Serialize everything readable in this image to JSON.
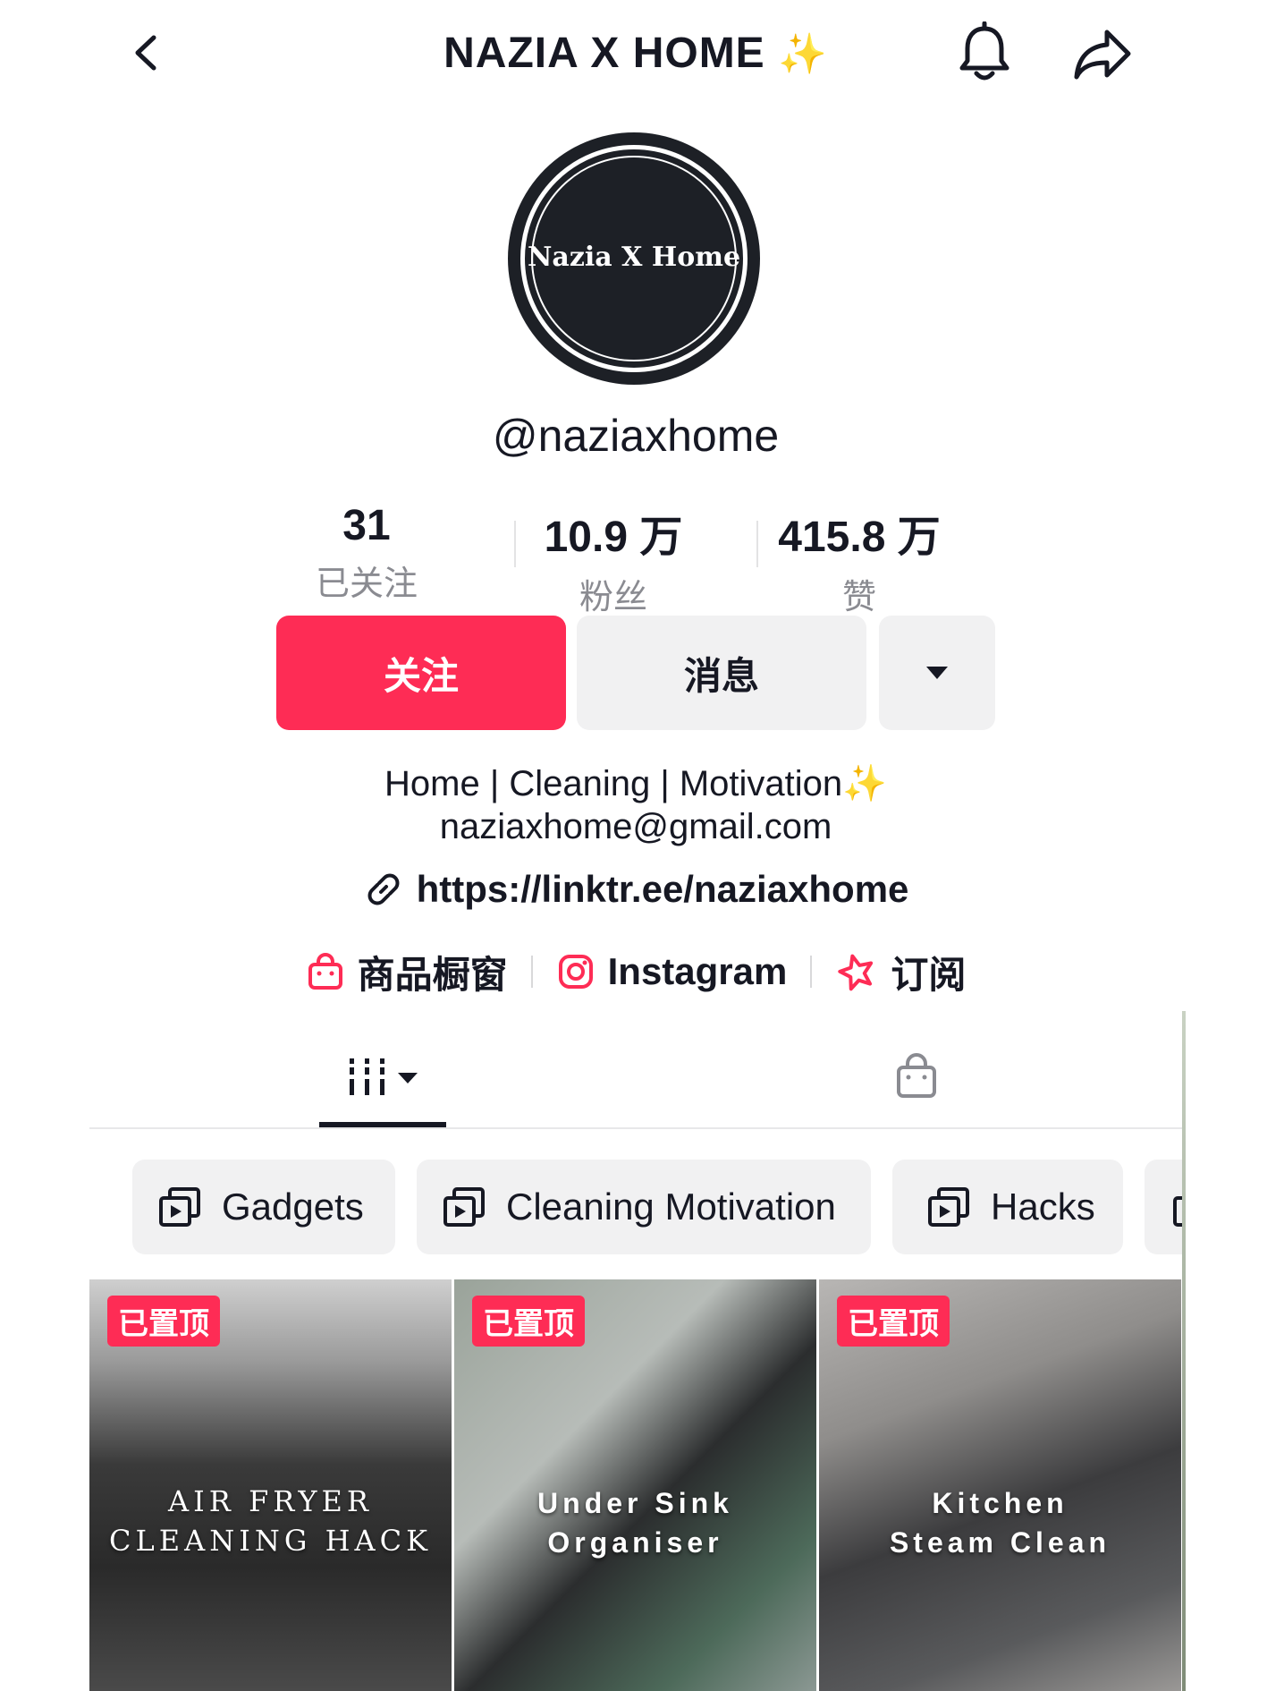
{
  "header": {
    "title": "NAZIA X HOME",
    "title_emoji": "✨"
  },
  "avatar": {
    "logo_text": "Nazia X Home"
  },
  "profile": {
    "handle": "@naziaxhome"
  },
  "stats": [
    {
      "value": "31",
      "label": "已关注"
    },
    {
      "value": "10.9 万",
      "label": "粉丝"
    },
    {
      "value": "415.8 万",
      "label": "赞"
    }
  ],
  "actions": {
    "follow_label": "关注",
    "message_label": "消息"
  },
  "bio": {
    "line1": "Home | Cleaning | Motivation",
    "line1_emoji": "✨",
    "line2": "naziaxhome@gmail.com",
    "link": "https://linktr.ee/naziaxhome"
  },
  "shortcuts": [
    {
      "label": "商品橱窗",
      "icon": "shop-bag-icon"
    },
    {
      "label": "Instagram",
      "icon": "instagram-icon"
    },
    {
      "label": "订阅",
      "icon": "subscribe-star-icon"
    }
  ],
  "playlists": [
    {
      "label": "Gadgets"
    },
    {
      "label": "Cleaning Motivation"
    },
    {
      "label": "Hacks"
    }
  ],
  "videos": [
    {
      "pin_label": "已置顶",
      "caption_line1": "AIR FRYER",
      "caption_line2": "CLEANING HACK"
    },
    {
      "pin_label": "已置顶",
      "caption_line1": "Under Sink",
      "caption_line2": "Organiser"
    },
    {
      "pin_label": "已置顶",
      "caption_line1": "Kitchen",
      "caption_line2": "Steam Clean"
    }
  ],
  "colors": {
    "accent": "#fe2c55",
    "button_gray": "#f1f1f2",
    "text": "#161823",
    "muted": "#8a8b91"
  }
}
